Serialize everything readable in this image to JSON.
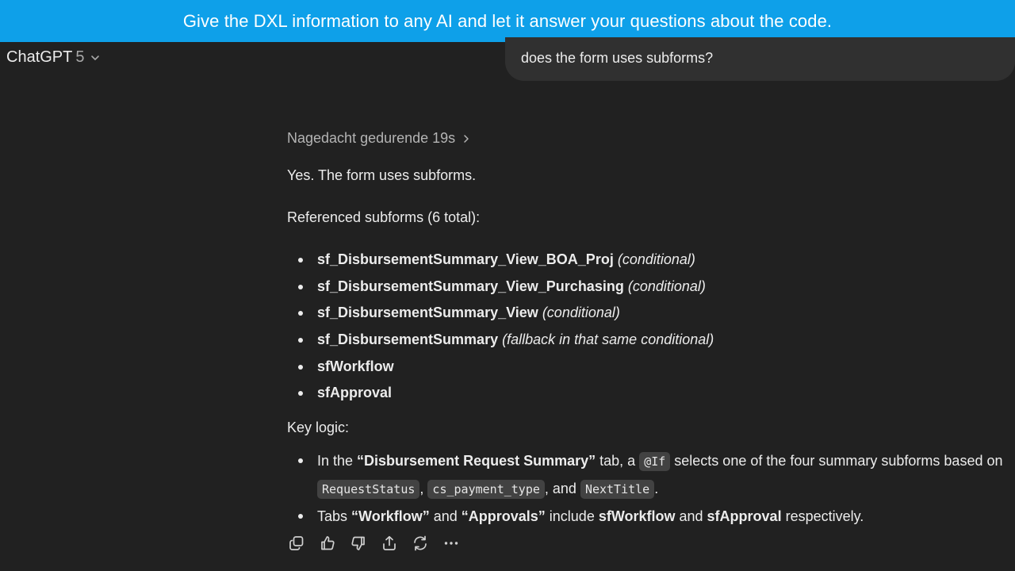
{
  "banner": {
    "text": "Give the DXL information to any AI and let it answer your questions about the code."
  },
  "header": {
    "model_name": "ChatGPT",
    "model_version": "5"
  },
  "user_message": {
    "text": "does the form uses subforms?"
  },
  "assistant": {
    "thought_label": "Nagedacht gedurende 19s",
    "intro": "Yes. The form uses subforms.",
    "referenced_heading": "Referenced subforms (6 total):",
    "subforms": [
      {
        "name": "sf_DisbursementSummary_View_BOA_Proj",
        "note": "(conditional)"
      },
      {
        "name": "sf_DisbursementSummary_View_Purchasing",
        "note": "(conditional)"
      },
      {
        "name": "sf_DisbursementSummary_View",
        "note": "(conditional)"
      },
      {
        "name": "sf_DisbursementSummary",
        "note": "(fallback in that same conditional)"
      },
      {
        "name": "sfWorkflow",
        "note": ""
      },
      {
        "name": "sfApproval",
        "note": ""
      }
    ],
    "key_logic_heading": "Key logic:",
    "logic": {
      "item1": {
        "t1": "In the ",
        "b1": "“Disbursement Request Summary”",
        "t2": " tab, a ",
        "c1": "@If",
        "t3": " selects one of the four summary subforms based on ",
        "c2": "RequestStatus",
        "t4": ", ",
        "c3": "cs_payment_type",
        "t5": ", and ",
        "c4": "NextTitle",
        "t6": "."
      },
      "item2": {
        "t1": "Tabs ",
        "b1": "“Workflow”",
        "t2": " and ",
        "b2": "“Approvals”",
        "t3": " include ",
        "b3": "sfWorkflow",
        "t4": " and ",
        "b4": "sfApproval",
        "t5": " respectively."
      }
    }
  },
  "actions": {
    "icons": [
      "copy-icon",
      "thumbs-up-icon",
      "thumbs-down-icon",
      "share-icon",
      "regenerate-icon",
      "more-icon"
    ]
  },
  "colors": {
    "background": "#212121",
    "banner": "#0ea0e9",
    "user_bubble": "#303030",
    "code_bg": "#424242"
  }
}
